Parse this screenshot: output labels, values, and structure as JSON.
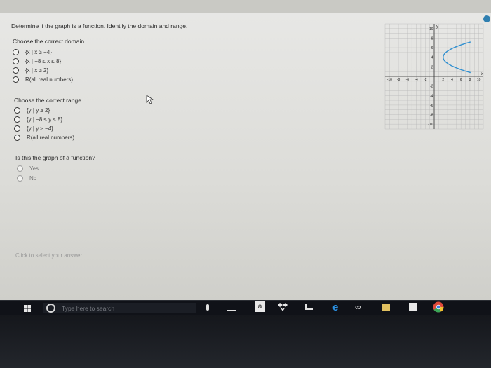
{
  "question": {
    "prompt": "Determine if the graph is a function. Identify the domain and range.",
    "domain_prompt": "Choose the correct domain.",
    "domain_options": [
      "{x | x ≥ −4}",
      "{x | −8 ≤ x ≤ 8}",
      "{x | x ≥ 2}",
      "R(all real numbers)"
    ],
    "range_prompt": "Choose the correct range.",
    "range_options": [
      "{y | y ≥ 2}",
      "{y | −8 ≤ y ≤ 8}",
      "{y | y ≥ −4}",
      "R(all real numbers)"
    ],
    "function_prompt": "Is this the graph of a function?",
    "function_options": [
      "Yes",
      "No"
    ],
    "hint": "Click to select your answer"
  },
  "graph": {
    "y_label": "y",
    "x_label": "x",
    "y_ticks": [
      "10",
      "8",
      "6",
      "4",
      "2",
      "-2",
      "-4",
      "-6",
      "-8",
      "-10"
    ],
    "x_ticks": [
      "-10",
      "-8",
      "-6",
      "-4",
      "-2",
      "2",
      "4",
      "6",
      "8",
      "10"
    ],
    "curve_color": "#2f8fd0"
  },
  "taskbar": {
    "search_placeholder": "Type here to search",
    "icons": [
      "windows-start-icon",
      "cortana-icon",
      "microphone-icon",
      "task-view-icon",
      "amazon-icon",
      "dropbox-icon",
      "app-icon",
      "edge-icon",
      "infinity-icon",
      "file-explorer-icon",
      "store-icon",
      "chrome-icon"
    ]
  }
}
